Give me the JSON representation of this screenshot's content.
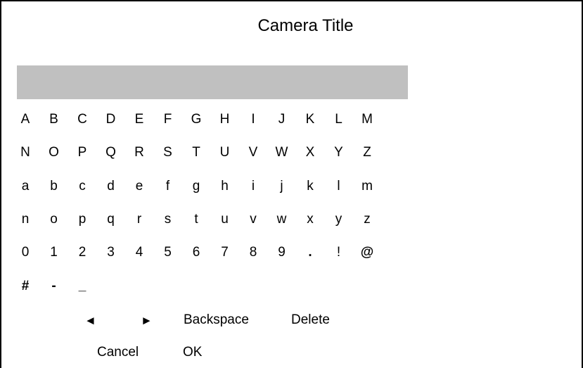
{
  "title": "Camera Title",
  "title_field": {
    "value": ""
  },
  "keyboard": {
    "rows": [
      [
        "A",
        "B",
        "C",
        "D",
        "E",
        "F",
        "G",
        "H",
        "I",
        "J",
        "K",
        "L",
        "M"
      ],
      [
        "N",
        "O",
        "P",
        "Q",
        "R",
        "S",
        "T",
        "U",
        "V",
        "W",
        "X",
        "Y",
        "Z"
      ],
      [
        "a",
        "b",
        "c",
        "d",
        "e",
        "f",
        "g",
        "h",
        "i",
        "j",
        "k",
        "l",
        "m"
      ],
      [
        "n",
        "o",
        "p",
        "q",
        "r",
        "s",
        "t",
        "u",
        "v",
        "w",
        "x",
        "y",
        "z"
      ],
      [
        "0",
        "1",
        "2",
        "3",
        "4",
        "5",
        "6",
        "7",
        "8",
        "9",
        ".",
        "!",
        "@"
      ],
      [
        "#",
        "-",
        "_"
      ]
    ]
  },
  "controls": {
    "left_arrow": "◄",
    "right_arrow": "►",
    "backspace": "Backspace",
    "delete": "Delete",
    "cancel": "Cancel",
    "ok": "OK"
  }
}
